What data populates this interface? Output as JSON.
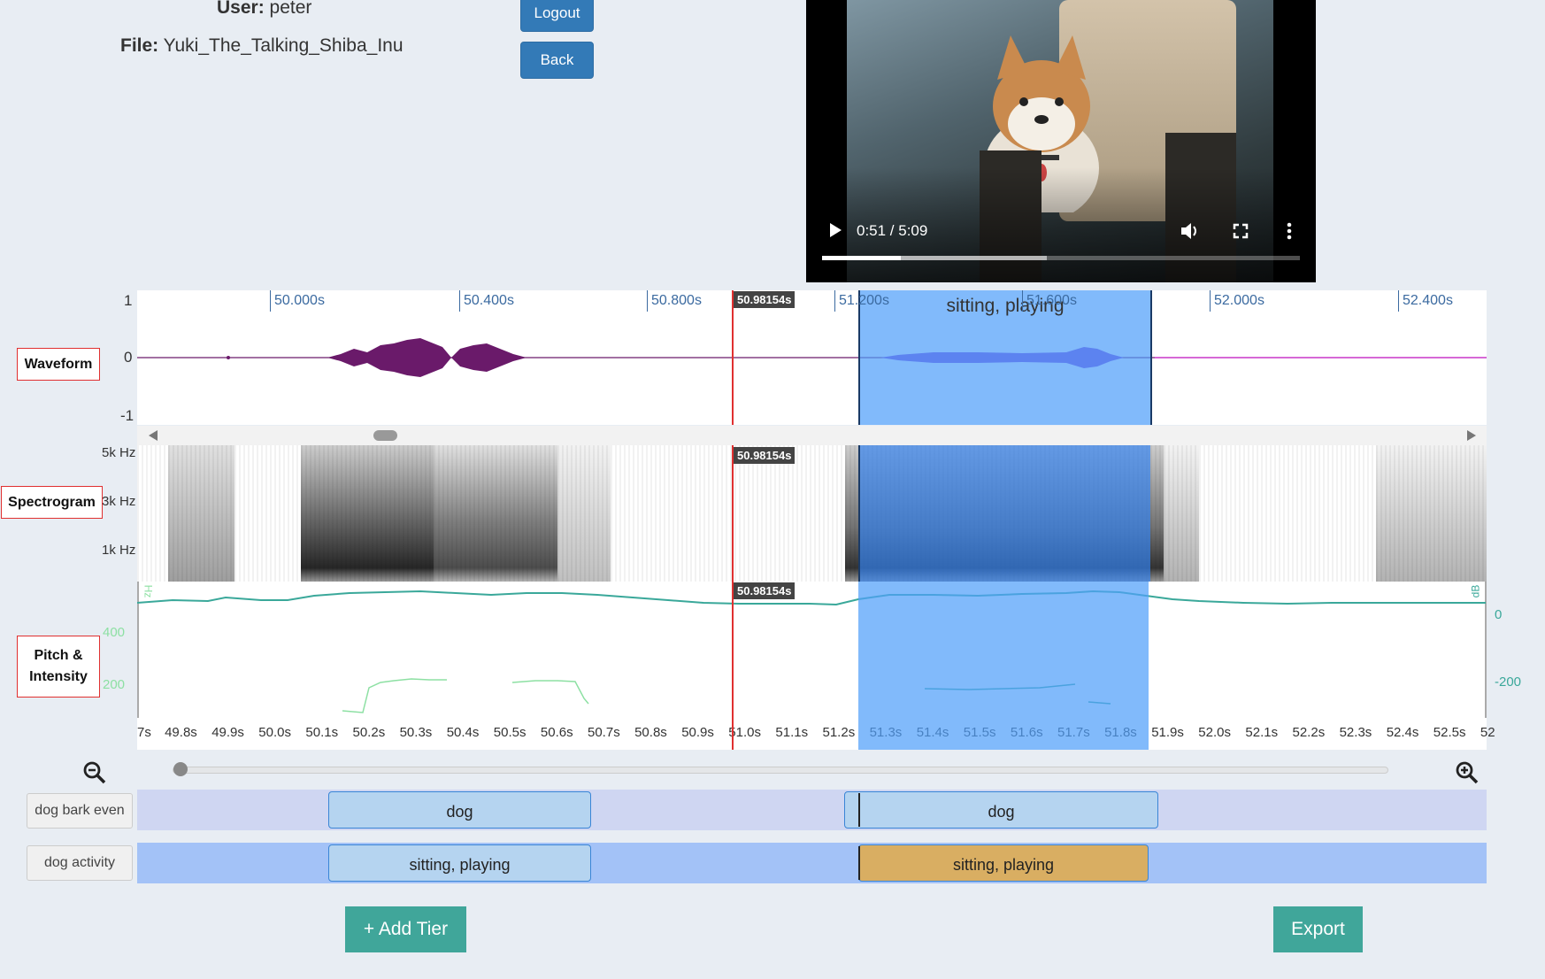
{
  "header": {
    "user_label": "User:",
    "user_value": "peter",
    "file_label": "File:",
    "file_value": "Yuki_The_Talking_Shiba_Inu",
    "logout_label": "Logout",
    "back_label": "Back"
  },
  "video": {
    "time_display": "0:51 / 5:09",
    "progress": 0.165,
    "buffered": 0.47
  },
  "waveform": {
    "label": "Waveform",
    "y_ticks": [
      "1",
      "0",
      "-1"
    ],
    "time_ticks": [
      "50.000s",
      "50.400s",
      "50.800s",
      "51.200s",
      "51.600s",
      "52.000s",
      "52.400s"
    ],
    "playhead_label": "50.98154s",
    "region_label": "sitting, playing"
  },
  "spectrogram": {
    "label": "Spectrogram",
    "y_ticks": [
      "5k Hz",
      "3k Hz",
      "1k Hz"
    ],
    "playhead_label": "50.98154s"
  },
  "pitch": {
    "label_line1": "Pitch &",
    "label_line2": "Intensity",
    "left_unit": "Hz",
    "right_unit": "dB",
    "left_ticks": [
      "400",
      "200"
    ],
    "right_ticks": [
      "0",
      "-200"
    ],
    "playhead_label": "50.98154s"
  },
  "timeline": {
    "ticks": [
      "7s",
      "49.8s",
      "49.9s",
      "50.0s",
      "50.1s",
      "50.2s",
      "50.3s",
      "50.4s",
      "50.5s",
      "50.6s",
      "50.7s",
      "50.8s",
      "50.9s",
      "51.0s",
      "51.1s",
      "51.2s",
      "51.3s",
      "51.4s",
      "51.5s",
      "51.6s",
      "51.7s",
      "51.8s",
      "51.9s",
      "52.0s",
      "52.1s",
      "52.2s",
      "52.3s",
      "52.4s",
      "52.5s",
      "52"
    ]
  },
  "zoom": {
    "level": 0.0
  },
  "tiers": [
    {
      "name": "dog bark even",
      "segments": [
        "dog",
        "dog"
      ]
    },
    {
      "name": "dog activity",
      "segments": [
        "sitting, playing",
        "sitting, playing"
      ]
    }
  ],
  "footer": {
    "add_tier_label": "+ Add Tier",
    "export_label": "Export"
  },
  "colors": {
    "selection": "#7fb9fb",
    "playhead": "#e03030",
    "waveform": "#6a1a6a",
    "pitch_intensity": "#3aa89a",
    "tier1_bg": "#cfd6f2",
    "tier2_bg": "#a3c2f7",
    "segment": "#b5d4f0",
    "segment_active": "#d9ae62"
  }
}
